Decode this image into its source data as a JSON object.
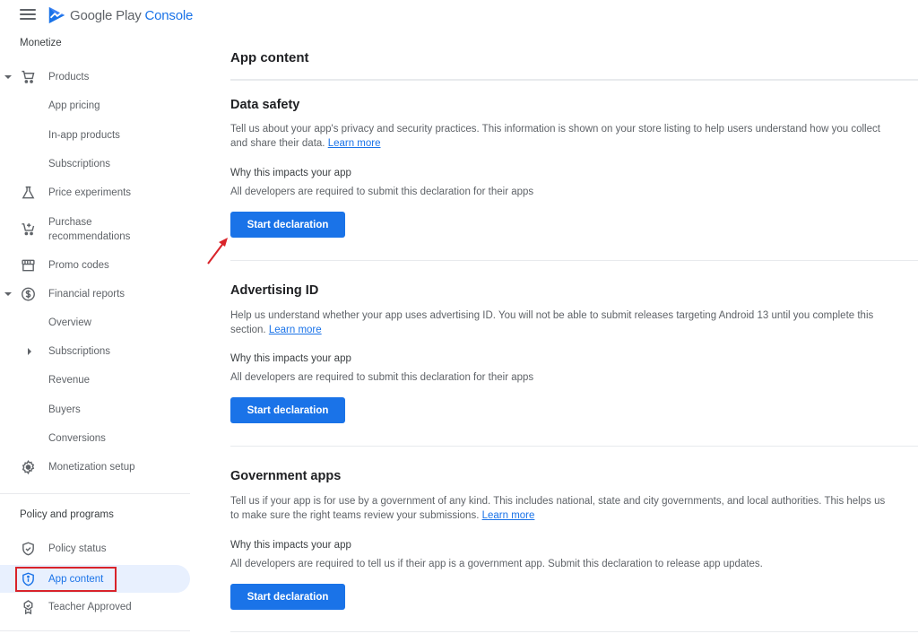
{
  "app": {
    "brand_primary": "Google Play",
    "brand_secondary": "Console",
    "accent_color": "#1a73e8",
    "annotation_color": "#d9232a"
  },
  "sidebar": {
    "monetize_title": "Monetize",
    "items": [
      {
        "label": "Products",
        "icon": "cart-icon",
        "expanded": true
      },
      {
        "label": "App pricing"
      },
      {
        "label": "In-app products"
      },
      {
        "label": "Subscriptions"
      },
      {
        "label": "Price experiments",
        "icon": "flask-icon"
      },
      {
        "label": "Purchase",
        "label2": "recommendations",
        "icon": "cart-plus-icon"
      },
      {
        "label": "Promo codes",
        "icon": "storefront-icon"
      },
      {
        "label": "Financial reports",
        "icon": "dollar-circle-icon",
        "expanded": true
      },
      {
        "label": "Overview"
      },
      {
        "label": "Subscriptions",
        "collapsed": true
      },
      {
        "label": "Revenue"
      },
      {
        "label": "Buyers"
      },
      {
        "label": "Conversions"
      },
      {
        "label": "Monetization setup",
        "icon": "gear-icon"
      }
    ],
    "policy_title": "Policy and programs",
    "policy_items": [
      {
        "label": "Policy status",
        "icon": "shield-check-icon"
      },
      {
        "label": "App content",
        "icon": "shield-info-icon",
        "active": true
      },
      {
        "label": "Teacher Approved",
        "icon": "badge-icon"
      }
    ]
  },
  "main": {
    "title": "App content",
    "sections": [
      {
        "title": "Data safety",
        "description": "Tell us about your app's privacy and security practices. This information is shown on your store listing to help users understand how you collect and share their data.",
        "link": "Learn more",
        "why_title": "Why this impacts your app",
        "why_text": "All developers are required to submit this declaration for their apps",
        "button": "Start declaration"
      },
      {
        "title": "Advertising ID",
        "description": "Help us understand whether your app uses advertising ID. You will not be able to submit releases targeting Android 13 until you complete this section.",
        "link": "Learn more",
        "why_title": "Why this impacts your app",
        "why_text": "All developers are required to submit this declaration for their apps",
        "button": "Start declaration"
      },
      {
        "title": "Government apps",
        "description": "Tell us if your app is for use by a government of any kind. This includes national, state and city governments, and local authorities. This helps us to make sure the right teams review your submissions.",
        "link": "Learn more",
        "why_title": "Why this impacts your app",
        "why_text": "All developers are required to tell us if their app is a government app. Submit this declaration to release app updates.",
        "button": "Start declaration"
      }
    ]
  }
}
